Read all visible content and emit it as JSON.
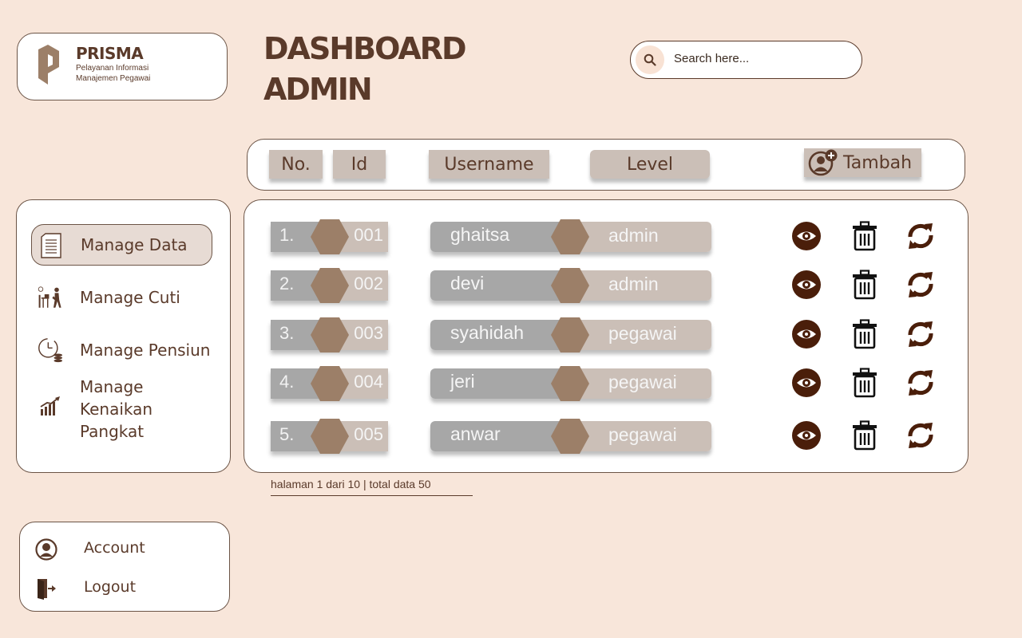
{
  "brand": {
    "name": "PRISMA",
    "subtitle_line1": "Pelayanan Informasi",
    "subtitle_line2": "Manajemen Pegawai"
  },
  "page": {
    "title_line1": "DASHBOARD",
    "title_line2": "ADMIN"
  },
  "search": {
    "placeholder": "Search here..."
  },
  "table": {
    "headers": {
      "no": "No.",
      "id": "Id",
      "username": "Username",
      "level": "Level",
      "add": "Tambah"
    },
    "rows": [
      {
        "no": "1.",
        "id": "001",
        "username": "ghaitsa",
        "level": "admin"
      },
      {
        "no": "2.",
        "id": "002",
        "username": "devi",
        "level": "admin"
      },
      {
        "no": "3.",
        "id": "003",
        "username": "syahidah",
        "level": "pegawai"
      },
      {
        "no": "4.",
        "id": "004",
        "username": "jeri",
        "level": "pegawai"
      },
      {
        "no": "5.",
        "id": "005",
        "username": "anwar",
        "level": "pegawai"
      }
    ],
    "row_actions": [
      "eye-icon",
      "trash-icon",
      "refresh-icon"
    ],
    "pagination": "halaman 1 dari 10 | total data 50"
  },
  "sidebar": {
    "items": [
      {
        "label": "Manage Data",
        "icon": "document-icon",
        "active": true
      },
      {
        "label": "Manage Cuti",
        "icon": "leave-icon"
      },
      {
        "label": "Manage Pensiun",
        "icon": "clock-coins-icon"
      },
      {
        "label": "Manage Kenaikan Pangkat",
        "icon": "growth-chart-icon"
      }
    ]
  },
  "account": {
    "items": [
      {
        "label": "Account",
        "icon": "user-circle-icon"
      },
      {
        "label": "Logout",
        "icon": "logout-door-icon"
      }
    ]
  },
  "colors": {
    "background": "#f8e6da",
    "brand_text": "#5a3a2a",
    "tag_fill": "#cbbfb7",
    "cell_gray": "#a7a7a7",
    "hexagon": "#9c7f68",
    "action_icon": "#4a1e0a"
  }
}
